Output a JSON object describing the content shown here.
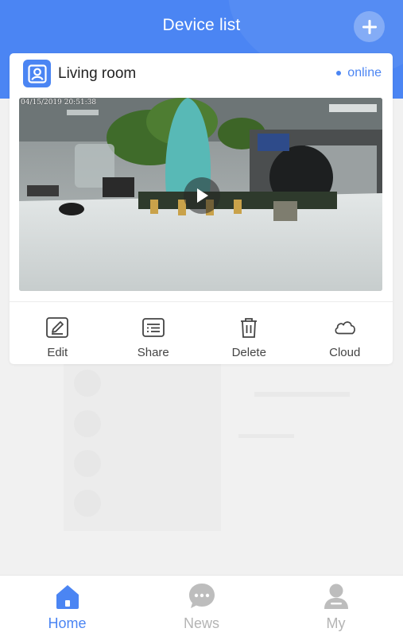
{
  "header": {
    "title": "Device list",
    "add_icon": "plus-icon"
  },
  "device": {
    "name": "Living room",
    "status": "online",
    "room_icon": "camera-user-icon",
    "timestamp": "04/15/2019 20:51:38",
    "play_icon": "play-icon"
  },
  "actions": [
    {
      "label": "Edit",
      "icon": "pencil-icon"
    },
    {
      "label": "Share",
      "icon": "share-list-icon"
    },
    {
      "label": "Delete",
      "icon": "trash-icon"
    },
    {
      "label": "Cloud",
      "icon": "cloud-icon"
    }
  ],
  "tabbar": {
    "items": [
      {
        "label": "Home",
        "icon": "home-icon",
        "active": true
      },
      {
        "label": "News",
        "icon": "chat-bubble-icon",
        "active": false
      },
      {
        "label": "My",
        "icon": "person-icon",
        "active": false
      }
    ]
  },
  "colors": {
    "primary": "#4b85f3",
    "inactive": "#b4b4b4",
    "background": "#f1f1f1"
  }
}
